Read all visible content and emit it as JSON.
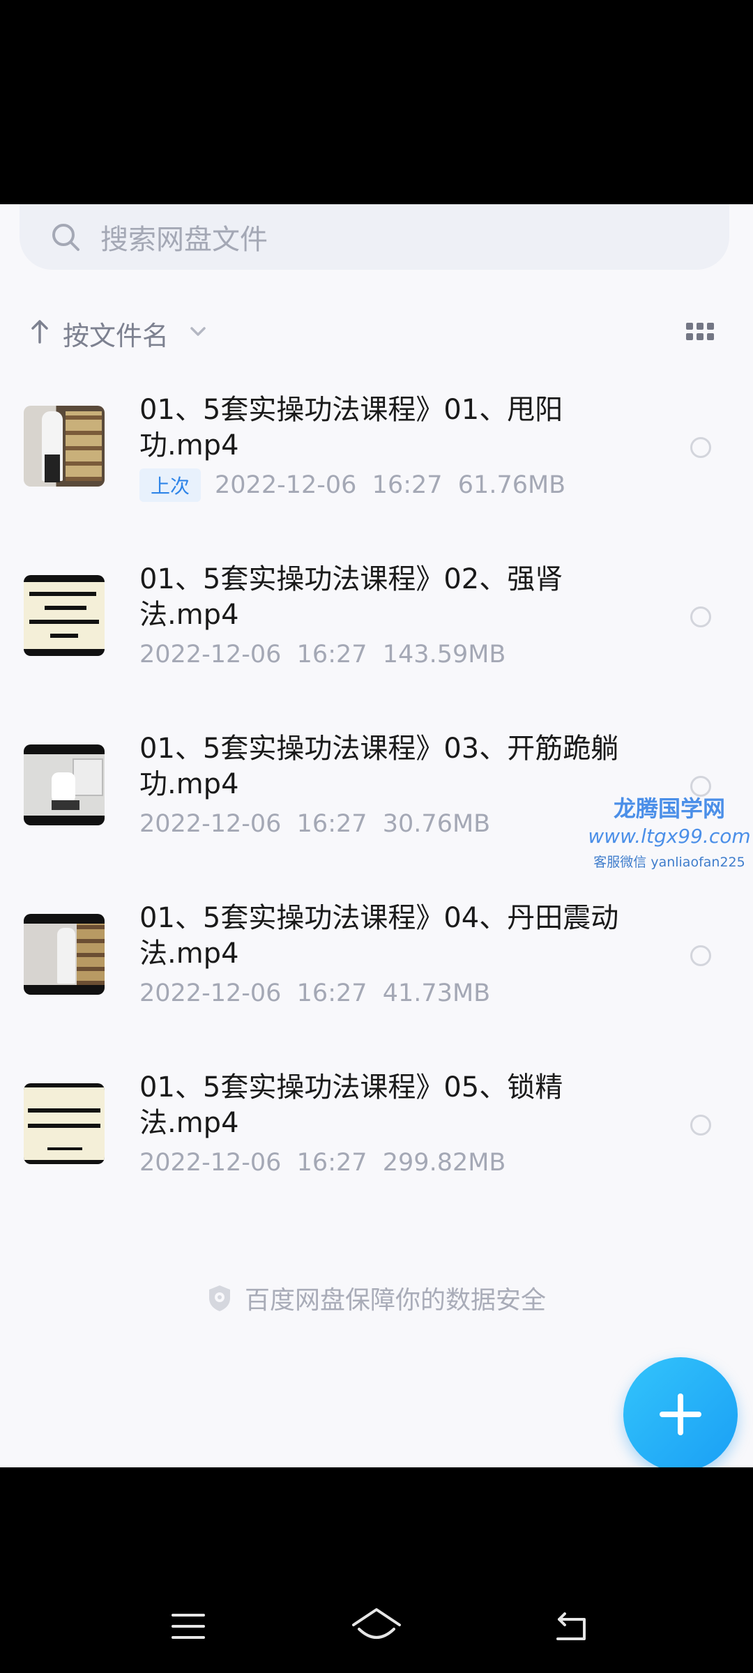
{
  "search": {
    "placeholder": "搜索网盘文件",
    "icon": "search-icon"
  },
  "sort": {
    "label": "按文件名",
    "arrow_icon": "arrow-up-icon",
    "chevron_icon": "chevron-down-icon",
    "view_icon": "grid-view-icon"
  },
  "files": [
    {
      "name": "01、5套实操功法课程》01、甩阳功.mp4",
      "badge": "上次",
      "meta": "2022-12-06  16:27  61.76MB"
    },
    {
      "name": "01、5套实操功法课程》02、强肾法.mp4",
      "badge": "",
      "meta": "2022-12-06  16:27  143.59MB"
    },
    {
      "name": "01、5套实操功法课程》03、开筋跪躺功.mp4",
      "badge": "",
      "meta": "2022-12-06  16:27  30.76MB"
    },
    {
      "name": "01、5套实操功法课程》04、丹田震动法.mp4",
      "badge": "",
      "meta": "2022-12-06  16:27  41.73MB"
    },
    {
      "name": "01、5套实操功法课程》05、锁精法.mp4",
      "badge": "",
      "meta": "2022-12-06  16:27  299.82MB"
    }
  ],
  "watermark": {
    "line1": "龙腾国学网",
    "line2": "www.ltgx99.com",
    "line3": "客服微信 yanliaofan225"
  },
  "footer": {
    "text": "百度网盘保障你的数据安全",
    "icon": "shield-icon"
  },
  "fab": {
    "icon": "plus-icon"
  },
  "nav": {
    "menu_icon": "menu-icon",
    "home_icon": "home-icon",
    "back_icon": "back-icon"
  },
  "colors": {
    "accent": "#1a9ff5",
    "badge": "#2f85e8",
    "text": "#1a1a1a",
    "muted": "#a4a8b5"
  }
}
